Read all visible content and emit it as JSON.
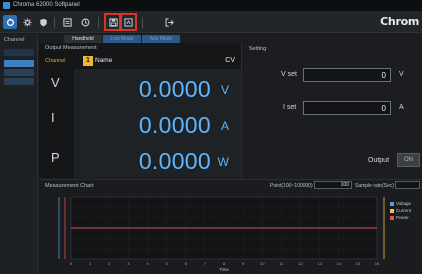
{
  "window": {
    "title": "Chroma 62000 Softpanel"
  },
  "brand": "Chrom",
  "channel_panel": {
    "header": "Channel"
  },
  "tabs": [
    "Handheld",
    "Low Mode",
    "Adv Mode"
  ],
  "output_measurement": {
    "title": "Output Measurement",
    "channel_label": "Channel",
    "channel_number": "1",
    "channel_name": "Name",
    "mode": "CV",
    "rows": [
      {
        "label": "V",
        "value": "0.0000",
        "unit": "V"
      },
      {
        "label": "I",
        "value": "0.0000",
        "unit": "A"
      },
      {
        "label": "P",
        "value": "0.0000",
        "unit": "W"
      }
    ]
  },
  "setting": {
    "title": "Setting",
    "vset_label": "V set",
    "vset_value": "0",
    "vset_unit": "V",
    "iset_label": "I set",
    "iset_value": "0",
    "iset_unit": "A",
    "output_label": "Output",
    "output_button": "ON"
  },
  "measurement_chart": {
    "title": "Measurement Chart",
    "point_label": "Point(100~100000)",
    "point_value": "100",
    "sample_rate_label": "Sample rate(Sec)",
    "sample_rate_value": "",
    "xlabel": "Time",
    "legend": [
      "Voltage",
      "Current",
      "Power"
    ]
  },
  "colors": {
    "accent": "#2d6fb4",
    "value_blue": "#5db5ff",
    "channel_yellow": "#f0b830",
    "highlight_red": "#d9342b",
    "voltage": "#4a9fe0",
    "current": "#e6c840",
    "power": "#e05050"
  },
  "chart_data": {
    "type": "line",
    "title": "Measurement Chart",
    "xlabel": "Time",
    "ylabel": "",
    "x": [
      0,
      1,
      2,
      3,
      4,
      5,
      6,
      7,
      8,
      9,
      10,
      11,
      12,
      13,
      14,
      15,
      16
    ],
    "xlim": [
      0,
      16
    ],
    "series": [
      {
        "name": "Voltage",
        "values": [
          0,
          0,
          0,
          0,
          0,
          0,
          0,
          0,
          0,
          0,
          0,
          0,
          0,
          0,
          0,
          0,
          0
        ]
      },
      {
        "name": "Current",
        "values": [
          0,
          0,
          0,
          0,
          0,
          0,
          0,
          0,
          0,
          0,
          0,
          0,
          0,
          0,
          0,
          0,
          0
        ]
      },
      {
        "name": "Power",
        "values": [
          0,
          0,
          0,
          0,
          0,
          0,
          0,
          0,
          0,
          0,
          0,
          0,
          0,
          0,
          0,
          0,
          0
        ]
      }
    ],
    "grid": true,
    "legend_position": "right"
  }
}
